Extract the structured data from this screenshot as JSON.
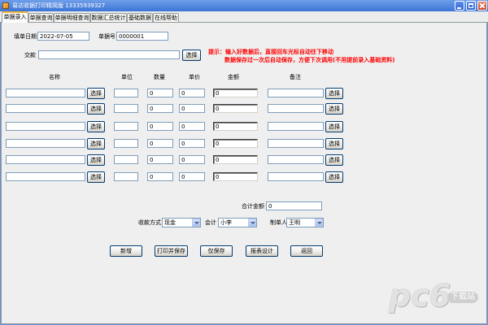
{
  "window": {
    "title": "易达收据打印精简版 13335939327"
  },
  "icons": {
    "app": "app-icon",
    "minimize": "minimize-icon",
    "maximize": "maximize-icon",
    "close": "close-icon",
    "dropdown": "chevron-down-icon"
  },
  "colors": {
    "title_bar": "#3b74d6",
    "close_button": "#c8401c",
    "hint_text": "#ff0000",
    "panel_background": "#efefef"
  },
  "tabs": [
    {
      "label": "单据录入",
      "active": true
    },
    {
      "label": "单据查询",
      "active": false
    },
    {
      "label": "单据明细查询",
      "active": false
    },
    {
      "label": "数据汇总统计",
      "active": false
    },
    {
      "label": "基础数据",
      "active": false
    },
    {
      "label": "在线帮助",
      "active": false
    }
  ],
  "form": {
    "date_label": "填单日期",
    "date_value": "2022-07-05",
    "number_label": "单据号",
    "number_value": "0000001",
    "payer_label": "交款",
    "payer_value": "",
    "select_label": "选择",
    "hint_line1": "提示：输入好数据后，直接回车光标自动往下移动",
    "hint_line2": "数据保存过一次后自动保存，方便下次调用(不用提前录入基础资料)"
  },
  "items": {
    "headers": {
      "name": "名称",
      "unit": "单位",
      "quantity": "数量",
      "price": "单价",
      "amount": "金额",
      "remark": "备注"
    },
    "select_label": "选择",
    "rows": [
      {
        "name": "",
        "unit": "",
        "quantity": "0",
        "price": "0",
        "amount": "0",
        "remark": ""
      },
      {
        "name": "",
        "unit": "",
        "quantity": "0",
        "price": "0",
        "amount": "0",
        "remark": ""
      },
      {
        "name": "",
        "unit": "",
        "quantity": "0",
        "price": "0",
        "amount": "0",
        "remark": ""
      },
      {
        "name": "",
        "unit": "",
        "quantity": "0",
        "price": "0",
        "amount": "0",
        "remark": ""
      },
      {
        "name": "",
        "unit": "",
        "quantity": "0",
        "price": "0",
        "amount": "0",
        "remark": ""
      },
      {
        "name": "",
        "unit": "",
        "quantity": "0",
        "price": "0",
        "amount": "0",
        "remark": ""
      }
    ]
  },
  "totals": {
    "label": "合计金额",
    "value": "0"
  },
  "payment": {
    "method_label": "收款方式",
    "method_value": "现金",
    "accountant_label": "会计",
    "accountant_value": "小李",
    "maker_label": "制单人",
    "maker_value": "王明"
  },
  "actions": {
    "new": "新增",
    "print_save": "打印并保存",
    "save_only": "仅保存",
    "report_design": "报表设计",
    "back": "返回"
  },
  "watermark": {
    "brand": "pc6",
    "site": "下载站"
  }
}
